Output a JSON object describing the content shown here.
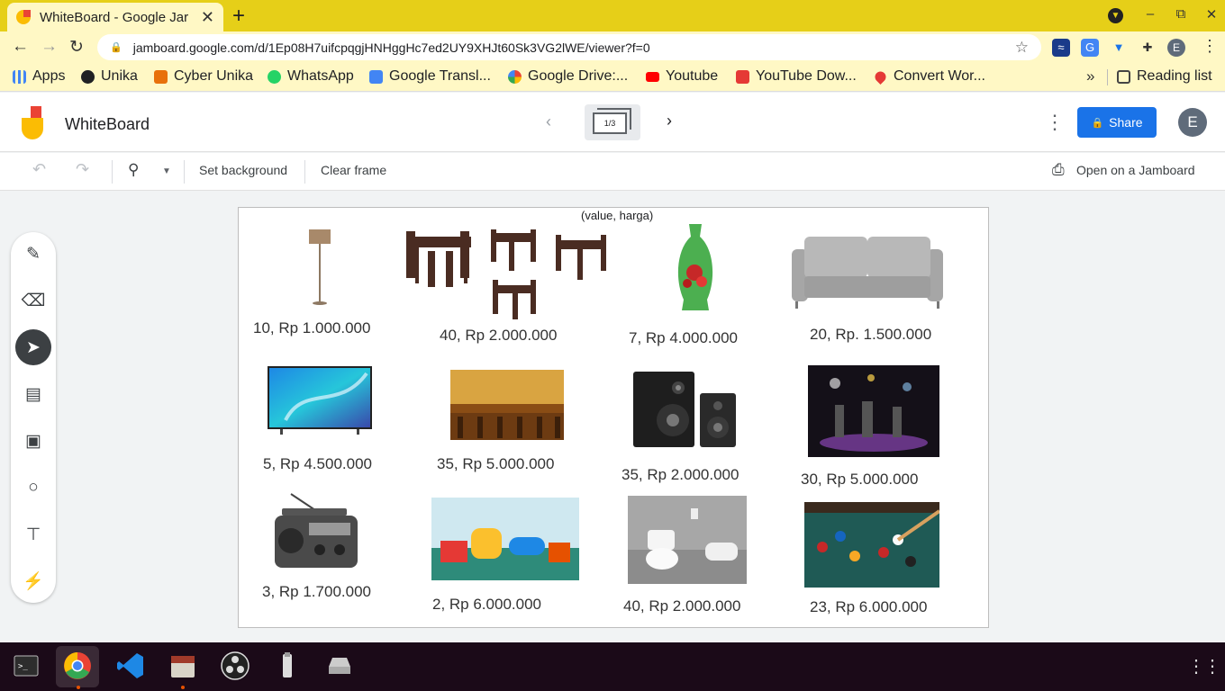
{
  "browser": {
    "tab_title": "WhiteBoard - Google Jar",
    "tab_close": "✕",
    "new_tab": "+",
    "url": "jamboard.google.com/d/1Ep08H7uifcpqgjHNHggHc7ed2UY9XHJt60Sk3VG2lWE/viewer?f=0",
    "profile_initial": "E",
    "window_controls": [
      "–",
      "⧉",
      "✕"
    ]
  },
  "bookmarks": {
    "items": [
      {
        "label": "Apps",
        "icon": "apps-grid-icon",
        "color": "#4285f4"
      },
      {
        "label": "Unika",
        "icon": "globe-icon",
        "color": "#202124"
      },
      {
        "label": "Cyber Unika",
        "icon": "unika-icon",
        "color": "#e8710a"
      },
      {
        "label": "WhatsApp",
        "icon": "whatsapp-icon",
        "color": "#25d366"
      },
      {
        "label": "Google Transl...",
        "icon": "translate-icon",
        "color": "#4285f4"
      },
      {
        "label": "Google Drive:...",
        "icon": "google-icon",
        "color": "#ea4335"
      },
      {
        "label": "Youtube",
        "icon": "youtube-icon",
        "color": "#ff0000"
      },
      {
        "label": "YouTube Dow...",
        "icon": "download-icon",
        "color": "#e53935"
      },
      {
        "label": "Convert Wor...",
        "icon": "convert-icon",
        "color": "#e53935"
      }
    ],
    "more": "»",
    "reading_list": "Reading list"
  },
  "app": {
    "name": "WhiteBoard",
    "frame_indicator": "1/3",
    "share_label": "Share",
    "avatar_initial": "E"
  },
  "subtoolbar": {
    "set_background": "Set background",
    "clear_frame": "Clear frame",
    "open_on_jamboard": "Open on a Jamboard"
  },
  "tools": [
    {
      "name": "pen-tool",
      "icon": "pen-icon"
    },
    {
      "name": "eraser-tool",
      "icon": "eraser-icon"
    },
    {
      "name": "select-tool",
      "icon": "cursor-icon",
      "active": true
    },
    {
      "name": "sticky-note-tool",
      "icon": "sticky-note-icon"
    },
    {
      "name": "image-tool",
      "icon": "image-icon"
    },
    {
      "name": "shape-tool",
      "icon": "circle-icon"
    },
    {
      "name": "text-box-tool",
      "icon": "text-box-icon"
    },
    {
      "name": "laser-tool",
      "icon": "laser-icon"
    }
  ],
  "board": {
    "header_note": "(value, harga)",
    "items": [
      {
        "caption": "10, Rp 1.000.000",
        "image": "floor-lamp"
      },
      {
        "caption": "40, Rp 2.000.000",
        "image": "dining-tables"
      },
      {
        "caption": "7, Rp 4.000.000",
        "image": "green-vase"
      },
      {
        "caption": "20, Rp. 1.500.000",
        "image": "grey-sofa"
      },
      {
        "caption": "5, Rp 4.500.000",
        "image": "television"
      },
      {
        "caption": "35, Rp 5.000.000",
        "image": "bar-counter"
      },
      {
        "caption": "35, Rp 2.000.000",
        "image": "speakers"
      },
      {
        "caption": "30, Rp 5.000.000",
        "image": "live-stage"
      },
      {
        "caption": "3, Rp 1.700.000",
        "image": "radio"
      },
      {
        "caption": "2, Rp 6.000.000",
        "image": "kids-playroom"
      },
      {
        "caption": "40, Rp 2.000.000",
        "image": "toilet"
      },
      {
        "caption": "23, Rp 6.000.000",
        "image": "billiard-table"
      }
    ]
  },
  "taskbar": {
    "apps": [
      "terminal-icon",
      "chrome-icon",
      "vscode-icon",
      "files-icon",
      "obs-icon",
      "usb-drive-icon",
      "disk-icon"
    ],
    "launcher": "⋮⋮⋮"
  }
}
